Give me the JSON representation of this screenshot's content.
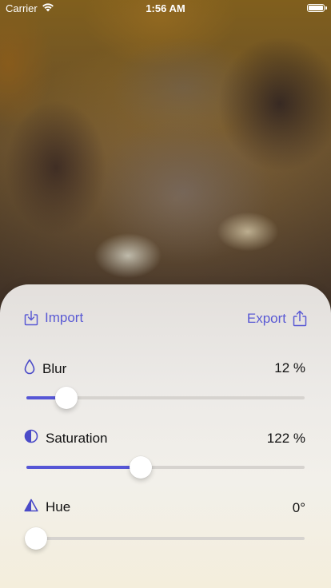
{
  "status_bar": {
    "carrier": "Carrier",
    "time": "1:56 AM"
  },
  "toolbar": {
    "import_label": "Import",
    "export_label": "Export"
  },
  "controls": [
    {
      "id": "blur",
      "label": "Blur",
      "icon": "drop-icon",
      "value_text": "12 %",
      "slider_fraction": 0.143
    },
    {
      "id": "saturation",
      "label": "Saturation",
      "icon": "half-circle-icon",
      "value_text": "122 %",
      "slider_fraction": 0.411
    },
    {
      "id": "hue",
      "label": "Hue",
      "icon": "triangle-half-icon",
      "value_text": "0°",
      "slider_fraction": 0.034
    }
  ],
  "colors": {
    "accent": "#5656d6",
    "track": "#d6d3cf",
    "text": "#111111"
  }
}
